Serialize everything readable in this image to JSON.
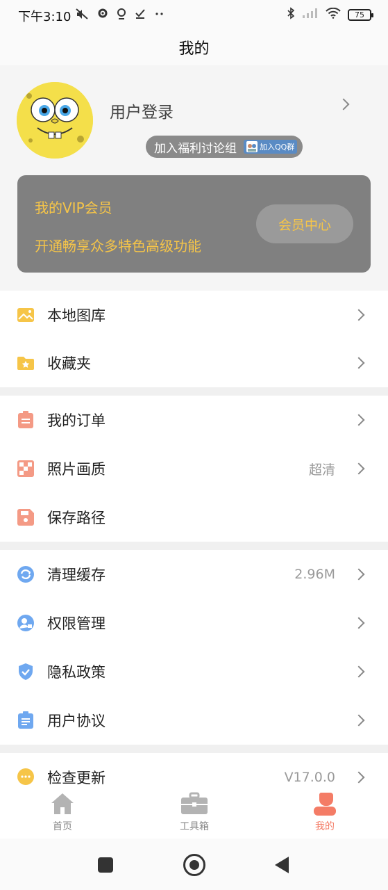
{
  "status_bar": {
    "time": "下午3:10",
    "left_icons": [
      "mute-icon",
      "gear-icon",
      "location-icon",
      "check-icon",
      "more-icon"
    ],
    "right_icons": [
      "bluetooth-icon",
      "signal-icon",
      "wifi-icon"
    ],
    "battery": "75"
  },
  "header": {
    "title": "我的"
  },
  "profile": {
    "login_text": "用户登录",
    "group_pill_label": "加入福利讨论组",
    "qq_badge": "加入QQ群"
  },
  "vip": {
    "title": "我的VIP会员",
    "subtitle": "开通畅享众多特色高级功能",
    "button": "会员中心",
    "accent": "#f6c548",
    "card_color": "#808080"
  },
  "sections": [
    {
      "items": [
        {
          "label": "本地图库",
          "value": "",
          "icon": "gallery-icon",
          "color": "#f6c548"
        },
        {
          "label": "收藏夹",
          "value": "",
          "icon": "folder-star-icon",
          "color": "#f6c548"
        }
      ]
    },
    {
      "items": [
        {
          "label": "我的订单",
          "value": "",
          "icon": "clipboard-icon",
          "color": "#f49a85"
        },
        {
          "label": "照片画质",
          "value": "超清",
          "icon": "quality-icon",
          "color": "#f49a85"
        },
        {
          "label": "保存路径",
          "value": "",
          "icon": "save-icon",
          "color": "#f49a85"
        }
      ]
    },
    {
      "items": [
        {
          "label": "清理缓存",
          "value": "2.96M",
          "icon": "refresh-icon",
          "color": "#6fa8f0"
        },
        {
          "label": "权限管理",
          "value": "",
          "icon": "user-lock-icon",
          "color": "#6fa8f0"
        },
        {
          "label": "隐私政策",
          "value": "",
          "icon": "shield-check-icon",
          "color": "#6fa8f0"
        },
        {
          "label": "用户协议",
          "value": "",
          "icon": "document-icon",
          "color": "#6fa8f0"
        }
      ]
    },
    {
      "items": [
        {
          "label": "检查更新",
          "value": "V17.0.0",
          "icon": "chat-bubble-icon",
          "color": "#f6c548"
        }
      ]
    }
  ],
  "bottom_nav": [
    {
      "label": "首页",
      "icon": "home-icon",
      "active": false
    },
    {
      "label": "工具箱",
      "icon": "toolbox-icon",
      "active": false
    },
    {
      "label": "我的",
      "icon": "person-icon",
      "active": true
    }
  ],
  "colors": {
    "active_tab": "#f47c66",
    "inactive_tab": "#888888"
  }
}
